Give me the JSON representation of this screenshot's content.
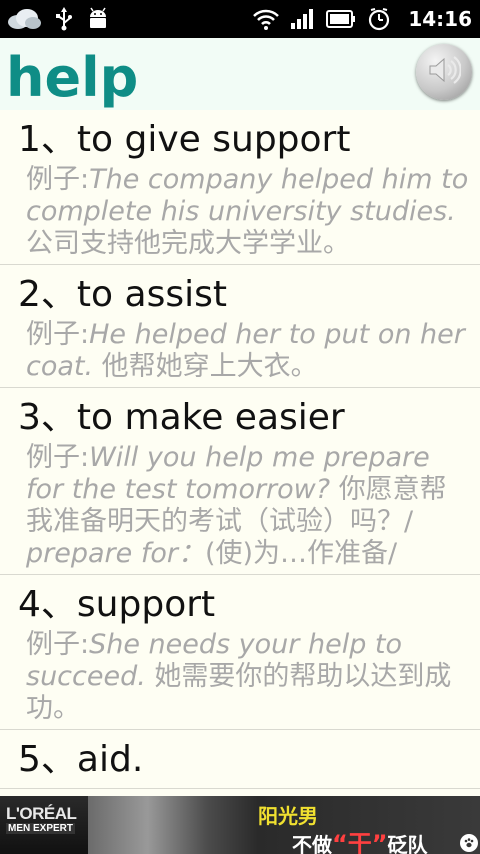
{
  "status_bar": {
    "time": "14:16",
    "icons": [
      "weather-cloud-icon",
      "usb-icon",
      "android-icon",
      "wifi-icon",
      "signal-icon",
      "battery-icon",
      "alarm-clock-icon"
    ]
  },
  "header": {
    "word": "help",
    "speaker_icon": "speaker-icon"
  },
  "definitions": [
    {
      "num": "1",
      "sep": "、",
      "term": "to give support",
      "example_label": "例子:",
      "example_en": "The company helped him to complete his university studies.",
      "example_zh": "公司支持他完成大学学业。"
    },
    {
      "num": "2",
      "sep": "、",
      "term": "to assist",
      "example_label": "例子:",
      "example_en": "He helped her to put on her coat.",
      "example_zh": "他帮她穿上大衣。"
    },
    {
      "num": "3",
      "sep": "、",
      "term": "to make easier",
      "example_label": "例子:",
      "example_en": "Will you help me prepare for the test tomorrow?",
      "example_zh": "你愿意帮我准备明天的考试（试验）吗？/ ",
      "example_extra_en": "prepare for：",
      "example_extra_zh": "(使)为…作准备/"
    },
    {
      "num": "4",
      "sep": "、",
      "term": "support",
      "example_label": "例子:",
      "example_en": "She needs your help to succeed.",
      "example_zh": "她需要你的帮助以达到成功。"
    },
    {
      "num": "5",
      "sep": "、",
      "term": "aid."
    }
  ],
  "ad": {
    "brand": "L'ORÉAL",
    "sub_brand": "MEN EXPERT",
    "line1": "阳光男",
    "line2_a": "不做",
    "line2_hl": "“干”",
    "line2_b": "砭队"
  },
  "colors": {
    "title": "#0f8d86",
    "example_text": "#a8a8a8",
    "background": "#fefef3",
    "header_bg": "#f2fcf6"
  }
}
